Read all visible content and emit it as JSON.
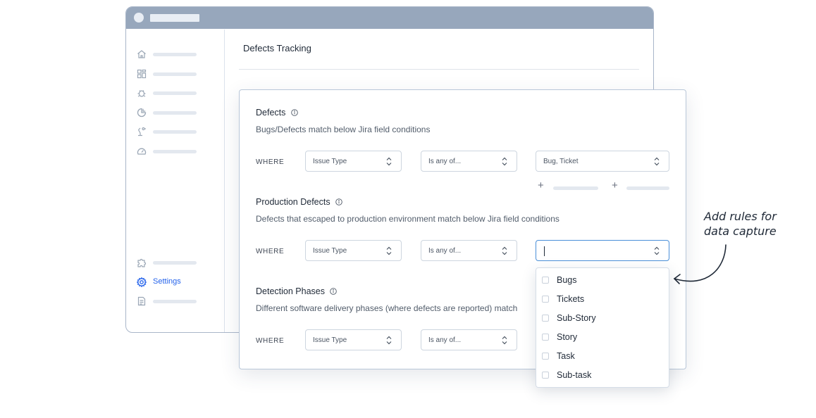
{
  "app": {
    "page_title": "Defects Tracking",
    "sidebar": {
      "icons": [
        "home-icon",
        "dashboard-icon",
        "bug-icon",
        "chart-icon",
        "robot-icon",
        "speedometer-icon",
        "puzzle-icon",
        "gear-icon",
        "document-icon"
      ],
      "settings_label": "Settings"
    }
  },
  "sections": [
    {
      "title": "Defects",
      "description": "Bugs/Defects match below Jira field conditions",
      "where": "WHERE",
      "field": "Issue Type",
      "operator": "Is any of...",
      "value": "Bug, Ticket"
    },
    {
      "title": "Production Defects",
      "description": "Defects that escaped to production environment match below Jira field conditions",
      "where": "WHERE",
      "field": "Issue Type",
      "operator": "Is any of...",
      "value": ""
    },
    {
      "title": "Detection Phases",
      "description": "Different software delivery phases (where defects are reported) match",
      "where": "WHERE",
      "field": "Issue Type",
      "operator": "Is any of..."
    }
  ],
  "add_buttons": [
    "+",
    "+"
  ],
  "dropdown": {
    "options": [
      "Bugs",
      "Tickets",
      "Sub-Story",
      "Story",
      "Task",
      "Sub-task"
    ]
  },
  "annotation": {
    "line1": "Add rules for",
    "line2": "data capture"
  },
  "colors": {
    "accent": "#2563eb",
    "titlebar": "#97a7bc",
    "active_border": "#4a8fd8"
  }
}
